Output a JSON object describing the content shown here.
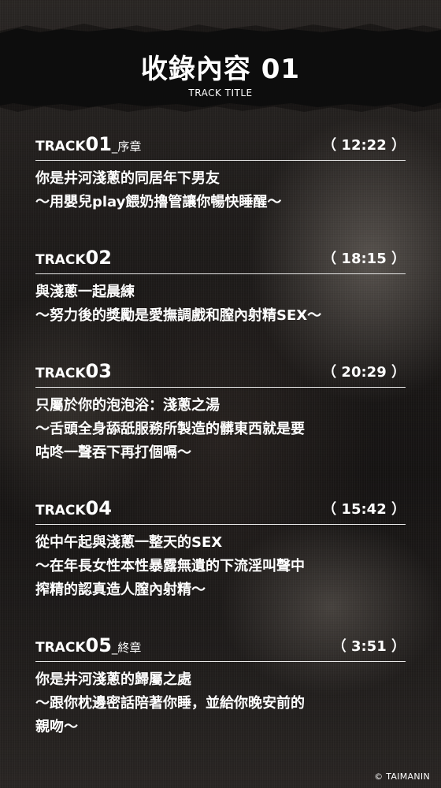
{
  "header": {
    "title": "收錄內容 01",
    "subtitle": "TRACK TITLE"
  },
  "tracks": [
    {
      "word": "TRACK",
      "num": "01",
      "suffix": "_序章",
      "time": "（ 12:22 ）",
      "lines": [
        "你是井河淺蔥的同居年下男友",
        "～用嬰兒play餵奶擼管讓你暢快睡醒～"
      ]
    },
    {
      "word": "TRACK",
      "num": "02",
      "suffix": "",
      "time": "（ 18:15 ）",
      "lines": [
        "與淺蔥一起晨練",
        "～努力後的獎勵是愛撫調戲和膣內射精SEX～"
      ]
    },
    {
      "word": "TRACK",
      "num": "03",
      "suffix": "",
      "time": "（ 20:29 ）",
      "lines": [
        "只屬於你的泡泡浴：淺蔥之湯",
        "～舌頭全身舔舐服務所製造的髒東西就是要",
        "咕咚一聲吞下再打個嗝～"
      ]
    },
    {
      "word": "TRACK",
      "num": "04",
      "suffix": "",
      "time": "（ 15:42 ）",
      "lines": [
        "從中午起與淺蔥一整天的SEX",
        "～在年長女性本性暴露無遺的下流淫叫聲中",
        "搾精的認真造人膣內射精～"
      ]
    },
    {
      "word": "TRACK",
      "num": "05",
      "suffix": "_終章",
      "time": "（ 3:51 ）",
      "lines": [
        "你是井河淺蔥的歸屬之處",
        "～跟你枕邊密話陪著你睡，並給你晚安前的",
        "親吻～"
      ]
    }
  ],
  "footer": {
    "copyright": "© TAIMANIN"
  }
}
